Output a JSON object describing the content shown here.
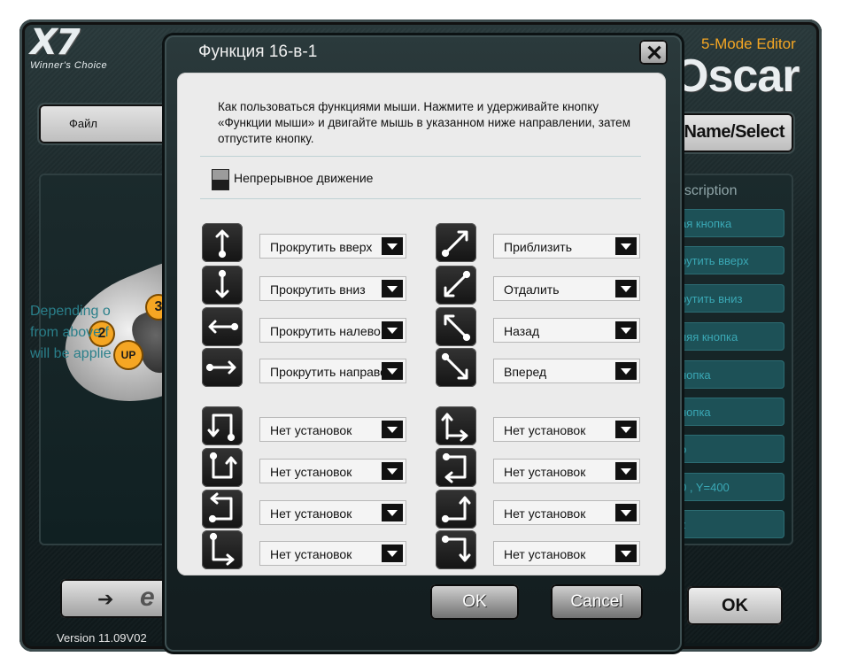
{
  "app": {
    "logo_main": "X7",
    "logo_sub": "Winner's Choice",
    "editor_label": "5-Mode Editor",
    "oscar_label": "Oscar",
    "file_select_label": "Файл",
    "name_select_label": "e Name/Select",
    "description_title": "escription",
    "description_items": [
      "ая кнопка",
      "рутить вверх",
      "рутить вниз",
      "няя кнопка",
      "нопка",
      "нопка",
      "о",
      "0 , Y=400",
      "z"
    ],
    "info_text": "Depending o\nfrom above f\nwill be applie",
    "badge_2": "2",
    "badge_3": "3",
    "badge_up": "UP",
    "version": "Version 11.09V02",
    "ok_label": "OK",
    "ie_arrow": "➔",
    "ie_letter": "e"
  },
  "dialog": {
    "title": "Функция 16-в-1",
    "close_label": "✕",
    "instructions": "Как пользоваться функциями мыши. Нажмите и удерживайте кнопку «Функции мыши» и двигайте мышь в указанном ниже направлении, затем отпустите кнопку.",
    "continuous_label": "Непрерывное движение",
    "left_rows": [
      {
        "icon": "arrow-up-icon",
        "value": "Прокрутить вверх"
      },
      {
        "icon": "arrow-down-icon",
        "value": "Прокрутить вниз"
      },
      {
        "icon": "arrow-left-icon",
        "value": "Прокрутить налево"
      },
      {
        "icon": "arrow-right-icon",
        "value": "Прокрутить направо"
      },
      {
        "icon": "up-left-down-icon",
        "value": "Нет установок"
      },
      {
        "icon": "down-right-up-icon",
        "value": "Нет установок"
      },
      {
        "icon": "right-up-left-icon",
        "value": "Нет установок"
      },
      {
        "icon": "up-down-right-icon",
        "value": "Нет установок"
      }
    ],
    "right_rows": [
      {
        "icon": "arrow-up-right-icon",
        "value": "Приблизить"
      },
      {
        "icon": "arrow-down-left-icon",
        "value": "Отдалить"
      },
      {
        "icon": "arrow-up-left-icon",
        "value": "Назад"
      },
      {
        "icon": "arrow-down-right-icon",
        "value": "Вперед"
      },
      {
        "icon": "up-down-right-corner-icon",
        "value": "Нет установок"
      },
      {
        "icon": "right-down-left-icon",
        "value": "Нет установок"
      },
      {
        "icon": "right-up-corner-icon",
        "value": "Нет установок"
      },
      {
        "icon": "right-down-corner-icon",
        "value": "Нет установок"
      }
    ],
    "ok_label": "OK",
    "cancel_label": "Cancel"
  }
}
